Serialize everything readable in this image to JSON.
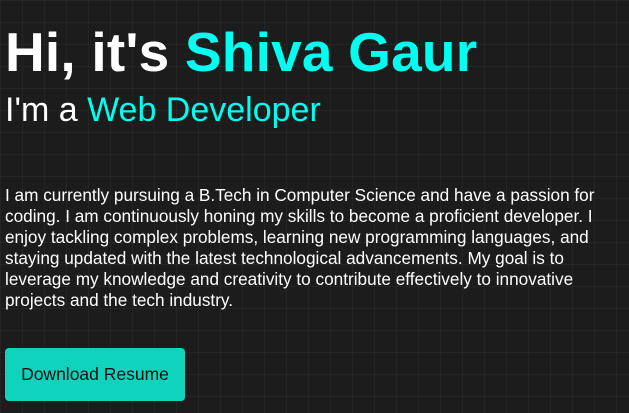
{
  "hero": {
    "greeting_prefix": "Hi, it's ",
    "name": "Shiva Gaur",
    "role_prefix": "I'm a ",
    "role": "Web Developer",
    "about": "I am currently pursuing a B.Tech in Computer Science and have a passion for coding. I am continuously honing my skills to become a proficient developer. I enjoy tackling complex problems, learning new programming languages, and staying updated with the latest technological advancements. My goal is to leverage my knowledge and creativity to contribute effectively to innovative projects and the tech industry.",
    "download_label": "Download Resume"
  },
  "colors": {
    "background": "#1c1c1c",
    "accent": "#00fff0",
    "button": "#0fd3bc",
    "text": "#ffffff"
  }
}
